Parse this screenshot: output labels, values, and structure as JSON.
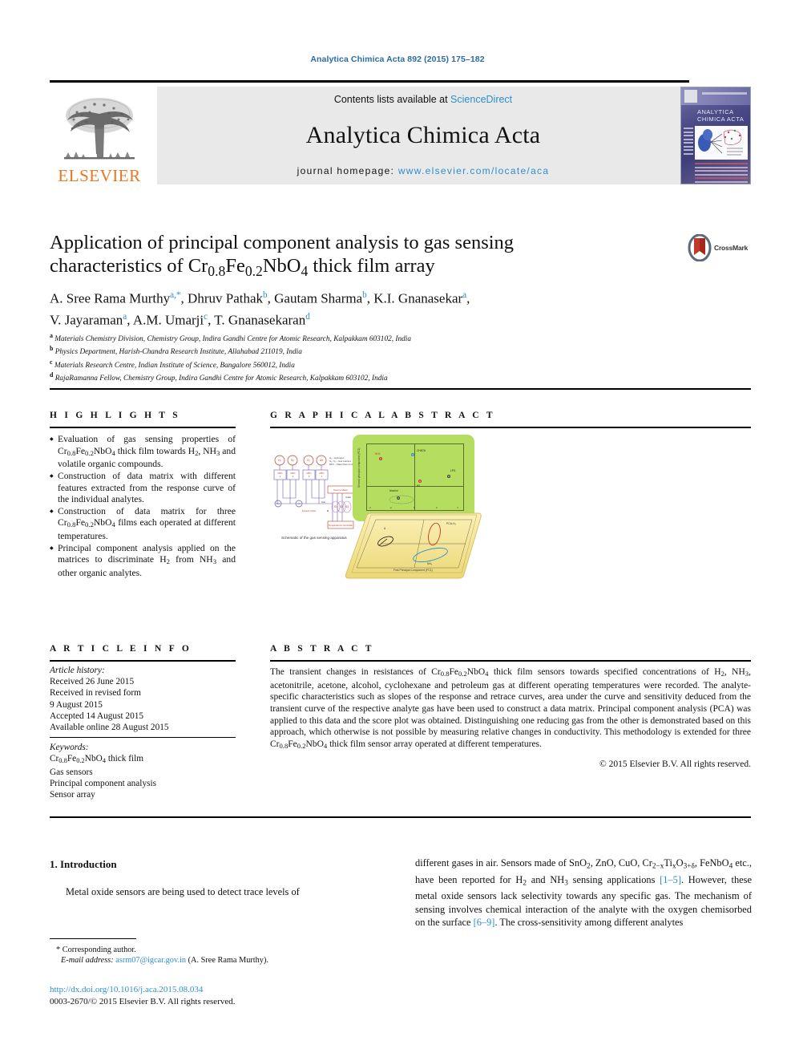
{
  "running_head": "Analytica Chimica Acta 892 (2015) 175–182",
  "masthead": {
    "contents_prefix": "Contents lists available at ",
    "contents_link": "ScienceDirect",
    "journal_name": "Analytica Chimica Acta",
    "homepage_prefix": "journal homepage: ",
    "homepage_url": "www.elsevier.com/locate/aca",
    "publisher": "ELSEVIER",
    "cover_title": "ANALYTICA CHIMICA ACTA"
  },
  "crossmark": {
    "label": "CrossMark"
  },
  "article": {
    "title_line1": "Application of principal component analysis to gas sensing",
    "title_line2_a": "characteristics of Cr",
    "title_sub1": "0.8",
    "title_line2_b": "Fe",
    "title_sub2": "0.2",
    "title_line2_c": "NbO",
    "title_sub3": "4",
    "title_line2_d": " thick film array",
    "authors_line1": "A. Sree Rama Murthy",
    "authors_line1_b": ", Dhruv Pathak",
    "authors_line1_c": ", Gautam Sharma",
    "authors_line1_d": ", K.I. Gnanasekar",
    "authors_line2_a": "V. Jayaraman",
    "authors_line2_b": ", A.M. Umarji",
    "authors_line2_c": ", T. Gnanasekaran",
    "affiliations": [
      {
        "mark": "a",
        "text": "Materials Chemistry Division, Chemistry Group, Indira Gandhi Centre for Atomic Research, Kalpakkam 603102, India"
      },
      {
        "mark": "b",
        "text": "Physics Department, Harish-Chandra Research Institute, Allahabad 211019, India"
      },
      {
        "mark": "c",
        "text": "Materials Research Centre, Indian Institute of Science, Bangalore 560012, India"
      },
      {
        "mark": "d",
        "text": "RajaRamanna Fellow, Chemistry Group, Indira Gandhi Centre for Atomic Research, Kalpakkam 603102, India"
      }
    ]
  },
  "highlights": {
    "heading": "H I G H L I G H T S",
    "items": [
      "Evaluation of gas sensing properties of Cr0.8Fe0.2NbO4 thick film towards H2, NH3 and volatile organic compounds.",
      "Construction of data matrix with different features extracted from the response curve of the individual analytes.",
      "Construction of data matrix for three Cr0.8Fe0.2NbO4 films each operated at different temperatures.",
      "Principal component analysis applied on the matrices to discriminate H2 from NH3 and other organic analytes."
    ]
  },
  "graphical_abstract": {
    "heading": "G R A P H I C A L  A B S T R A C T",
    "schematic_caption": "Schematic of the gas sensing apparatus",
    "plot": {
      "xlabel": "First principal component (PC1)",
      "ylabel": "Second principal component (PC2)",
      "point_labels": [
        "NH3",
        "H2",
        "Acetone",
        "CH3CN",
        "Alcohol",
        "LPG"
      ],
      "xticks": [
        "-4",
        "-2",
        "0",
        "2",
        "4"
      ],
      "yticks": [
        "-2",
        "0",
        "2",
        "4"
      ]
    },
    "lower_plot": {
      "xlabel": "First Principal Component (PC1)"
    }
  },
  "article_info": {
    "heading": "A R T I C L E  I N F O",
    "history_label": "Article history:",
    "history": [
      "Received 26 June 2015",
      "Received in revised form",
      "9 August 2015",
      "Accepted 14 August 2015",
      "Available online 28 August 2015"
    ],
    "keywords_label": "Keywords:",
    "keywords": [
      "Cr0.8Fe0.2NbO4 thick film",
      "Gas sensors",
      "Principal component analysis",
      "Sensor array"
    ]
  },
  "abstract": {
    "heading": "A B S T R A C T",
    "text": "The transient changes in resistances of Cr0.8Fe0.2NbO4 thick film sensors towards specified concentrations of H2, NH3, acetonitrile, acetone, alcohol, cyclohexane and petroleum gas at different operating temperatures were recorded. The analyte-specific characteristics such as slopes of the response and retrace curves, area under the curve and sensitivity deduced from the transient curve of the respective analyte gas have been used to construct a data matrix. Principal component analysis (PCA) was applied to this data and the score plot was obtained. Distinguishing one reducing gas from the other is demonstrated based on this approach, which otherwise is not possible by measuring relative changes in conductivity. This methodology is extended for three Cr0.8Fe0.2NbO4 thick film sensor array operated at different temperatures.",
    "copyright": "© 2015 Elsevier B.V. All rights reserved."
  },
  "introduction": {
    "number_title": "1. Introduction",
    "left_text": "Metal oxide sensors are being used to detect trace levels of",
    "right_text": "different gases in air. Sensors made of SnO2, ZnO, CuO, Cr2−xTixO3+δ, FeNbO4 etc., have been reported for H2 and NH3 sensing applications [1–5]. However, these metal oxide sensors lack selectivity towards any specific gas. The mechanism of sensing involves chemical interaction of the analyte with the oxygen chemisorbed on the surface [6–9]. The cross-sensitivity among different analytes"
  },
  "footer": {
    "corresponding_author": "* Corresponding author.",
    "email_label": "E-mail address: ",
    "email": "asrm07@igcar.gov.in",
    "email_suffix": " (A. Sree Rama Murthy).",
    "doi": "http://dx.doi.org/10.1016/j.aca.2015.08.034",
    "issn": "0003-2670/© 2015 Elsevier B.V. All rights reserved."
  },
  "colors": {
    "link": "#2b8fd0",
    "elsevier_orange": "#E87722",
    "band_gray": "#e9e9e9",
    "green_card": "#b5dd5f",
    "yellow_card": "#f6e9a8"
  }
}
